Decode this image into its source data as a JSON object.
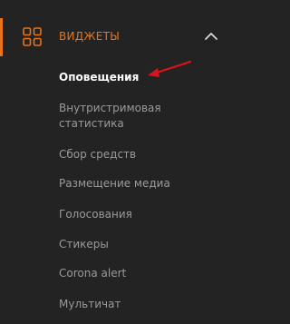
{
  "section": {
    "title": "ВИДЖЕТЫ",
    "icon": "grid-icon",
    "toggle_icon": "chevron-up-icon",
    "accent_color": "#e8731a"
  },
  "items": [
    {
      "label": "Оповещения",
      "active": true
    },
    {
      "label": "Внутристримовая статистика",
      "active": false
    },
    {
      "label": "Сбор средств",
      "active": false
    },
    {
      "label": "Размещение медиа",
      "active": false
    },
    {
      "label": "Голосования",
      "active": false
    },
    {
      "label": "Стикеры",
      "active": false
    },
    {
      "label": "Corona alert",
      "active": false
    },
    {
      "label": "Мультичат",
      "active": false
    }
  ],
  "annotation": {
    "icon": "red-arrow-icon",
    "color": "#d9141a"
  }
}
